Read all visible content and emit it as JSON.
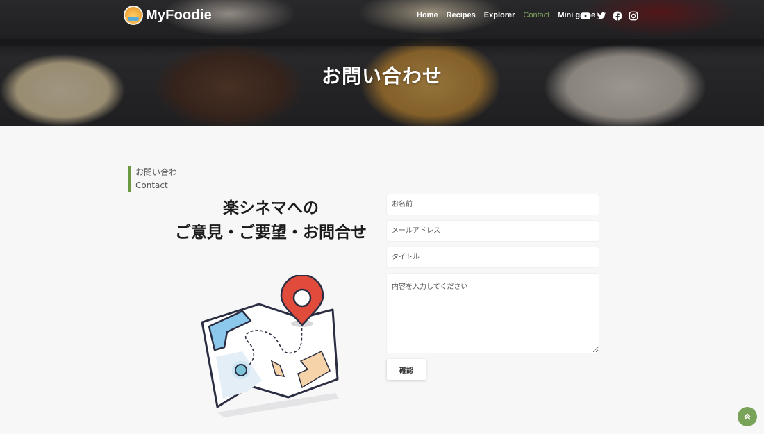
{
  "brand": {
    "name": "MyFoodie"
  },
  "nav": {
    "items": [
      {
        "label": "Home",
        "active": false
      },
      {
        "label": "Recipes",
        "active": false
      },
      {
        "label": "Explorer",
        "active": false
      },
      {
        "label": "Contact",
        "active": true
      },
      {
        "label": "Mini game",
        "active": false
      }
    ],
    "social": [
      "youtube-icon",
      "twitter-icon",
      "facebook-icon",
      "instagram-icon"
    ]
  },
  "hero": {
    "title": "お問い合わせ"
  },
  "section": {
    "label_ja": "お問い合わ",
    "label_en": "Contact"
  },
  "lead": {
    "line1": "楽シネマへの",
    "line2": "ご意見・ご要望・お問合せ"
  },
  "form": {
    "name_placeholder": "お名前",
    "email_placeholder": "メールアドレス",
    "title_placeholder": "タイトル",
    "content_placeholder": "内容を入力してください",
    "submit_label": "確認"
  },
  "colors": {
    "accent": "#6d9943",
    "active_link": "#7fa65a",
    "to_top": "#7aa35a"
  }
}
